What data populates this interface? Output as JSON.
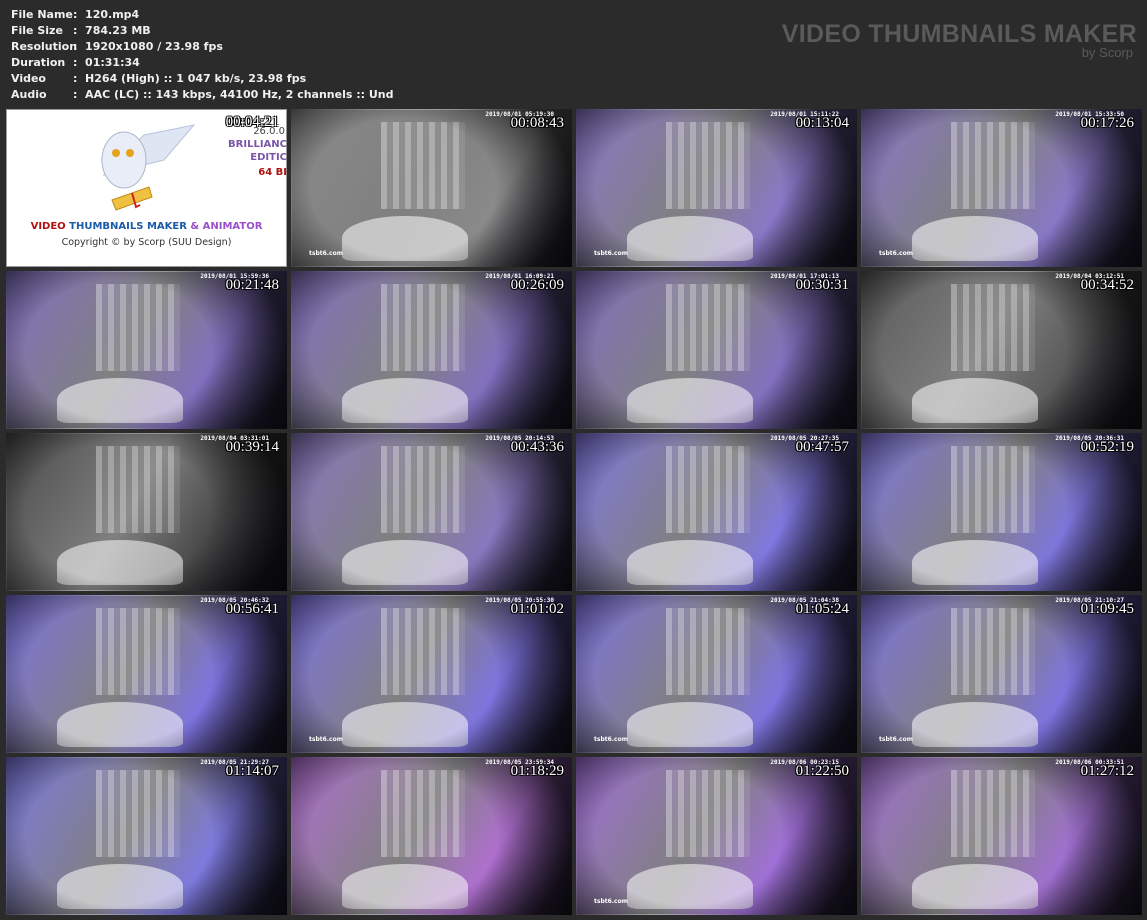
{
  "file_info": [
    {
      "label": "File Name",
      "value": ":  120.mp4"
    },
    {
      "label": "File Size",
      "value": ":  784.23 MB"
    },
    {
      "label": "Resolution",
      "value": ":  1920x1080 / 23.98 fps"
    },
    {
      "label": "Duration",
      "value": ":  01:31:34"
    },
    {
      "label": "Video",
      "value": ":  H264 (High) :: 1 047 kb/s, 23.98 fps"
    },
    {
      "label": "Audio",
      "value": ":  AAC (LC) :: 143 kbps, 44100 Hz, 2 channels :: Und"
    }
  ],
  "brand": {
    "title": "VIDEO THUMBNAILS MAKER",
    "subtitle": "by Scorp"
  },
  "logo": {
    "timestamp": "00:04:21",
    "version": "26.0.0",
    "edition_line1": "BRILLIANC",
    "edition_line2": "EDITIC",
    "bits": "64 BI",
    "product": {
      "video": "VIDEO",
      "thumbnails": "THUMBNAILS MAKER",
      "amp": "&",
      "animator": "ANIMATOR"
    },
    "copyright": "Copyright © by Scorp (SUU Design)"
  },
  "thumbnails": [
    {
      "timestamp": "00:08:43",
      "camera": "2019/08/01 05:19:30",
      "watermark": "tsbt6.com",
      "tone": "#8a8a8a"
    },
    {
      "timestamp": "00:13:04",
      "camera": "2019/08/01 15:11:22",
      "watermark": "tsbt6.com",
      "tone": "#8a78c8"
    },
    {
      "timestamp": "00:17:26",
      "camera": "2019/08/01 15:33:50",
      "watermark": "tsbt6.com",
      "tone": "#8878c8"
    },
    {
      "timestamp": "00:21:48",
      "camera": "2019/08/01 15:59:36",
      "watermark": "",
      "tone": "#8270c0"
    },
    {
      "timestamp": "00:26:09",
      "camera": "2019/08/01 16:09:21",
      "watermark": "",
      "tone": "#8270c0"
    },
    {
      "timestamp": "00:30:31",
      "camera": "2019/08/01 17:01:13",
      "watermark": "",
      "tone": "#8270c0"
    },
    {
      "timestamp": "00:34:52",
      "camera": "2019/08/04 03:12:51",
      "watermark": "",
      "tone": "#5a5a5a"
    },
    {
      "timestamp": "00:39:14",
      "camera": "2019/08/04 03:31:01",
      "watermark": "",
      "tone": "#4a4a4a"
    },
    {
      "timestamp": "00:43:36",
      "camera": "2019/08/05 20:14:53",
      "watermark": "",
      "tone": "#8878c0"
    },
    {
      "timestamp": "00:47:57",
      "camera": "2019/08/05 20:27:35",
      "watermark": "",
      "tone": "#8078e0"
    },
    {
      "timestamp": "00:52:19",
      "camera": "2019/08/05 20:36:31",
      "watermark": "",
      "tone": "#7e76dc"
    },
    {
      "timestamp": "00:56:41",
      "camera": "2019/08/05 20:46:32",
      "watermark": "",
      "tone": "#7e74e0"
    },
    {
      "timestamp": "01:01:02",
      "camera": "2019/08/05 20:55:30",
      "watermark": "tsbt6.com",
      "tone": "#7e74e0"
    },
    {
      "timestamp": "01:05:24",
      "camera": "2019/08/05 21:04:38",
      "watermark": "tsbt6.com",
      "tone": "#7e74e0"
    },
    {
      "timestamp": "01:09:45",
      "camera": "2019/08/05 21:10:27",
      "watermark": "tsbt6.com",
      "tone": "#7e74e0"
    },
    {
      "timestamp": "01:14:07",
      "camera": "2019/08/05 21:29:27",
      "watermark": "",
      "tone": "#7e7ae0"
    },
    {
      "timestamp": "01:18:29",
      "camera": "2019/08/05 23:59:34",
      "watermark": "",
      "tone": "#b070d0"
    },
    {
      "timestamp": "01:22:50",
      "camera": "2019/08/06 00:23:15",
      "watermark": "tsbt6.com",
      "tone": "#a070d8"
    },
    {
      "timestamp": "01:27:12",
      "camera": "2019/08/06 00:33:51",
      "watermark": "",
      "tone": "#a070d0"
    }
  ]
}
